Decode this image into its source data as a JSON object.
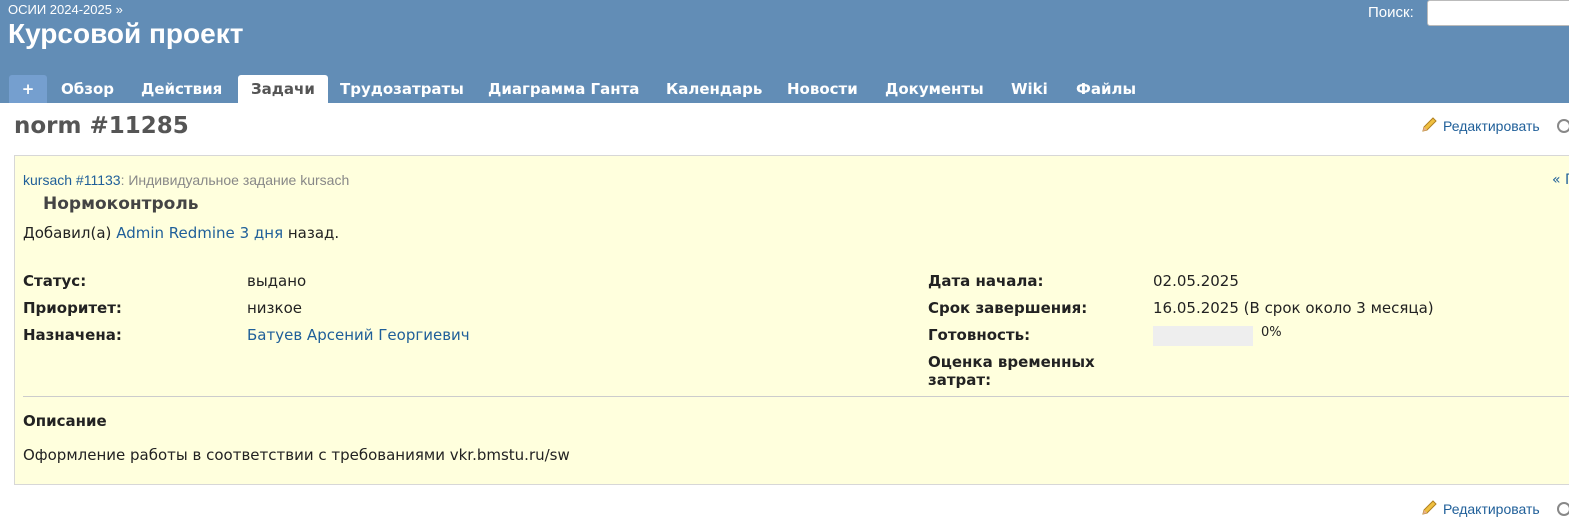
{
  "header": {
    "breadcrumb": "ОСИИ 2024-2025 »",
    "project_title": "Курсовой проект",
    "search_label": "Поиск:",
    "search_value": ""
  },
  "menu": {
    "plus": "+",
    "tabs": [
      "Обзор",
      "Действия",
      "Задачи",
      "Трудозатраты",
      "Диаграмма Ганта",
      "Календарь",
      "Новости",
      "Документы",
      "Wiki",
      "Файлы"
    ],
    "selected": "Задачи"
  },
  "issue": {
    "title": "norm #11285",
    "edit_label": "Редактировать",
    "parent_link": "kursach #11133",
    "parent_sep": ":",
    "parent_subject": "Индивидуальное задание kursach",
    "prev_nav": "« П",
    "subject": "Нормоконтроль",
    "author_prefix": "Добавил(а)",
    "author": "Admin Redmine",
    "age": "3 дня",
    "author_suffix": "назад.",
    "attributes": {
      "status_label": "Статус:",
      "status": "выдано",
      "priority_label": "Приоритет:",
      "priority": "низкое",
      "assignee_label": "Назначена:",
      "assignee": "Батуев Арсений Георгиевич",
      "start_label": "Дата начала:",
      "start": "02.05.2025",
      "due_label": "Срок завершения:",
      "due": "16.05.2025 (В срок около 3 месяца)",
      "done_label": "Готовность:",
      "done": "0%",
      "done_ratio": 0,
      "estimate_label_line1": "Оценка временных",
      "estimate_label_line2": "затрат:"
    },
    "description_title": "Описание",
    "description": "Оформление работы в соответствии с требованиями vkr.bmstu.ru/sw"
  },
  "colors": {
    "header_bg": "#628db6",
    "box_bg": "#ffffdd",
    "link": "#1f5f99"
  }
}
